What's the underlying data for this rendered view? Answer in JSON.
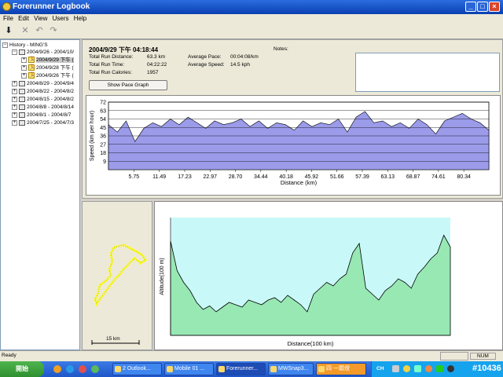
{
  "window": {
    "title": "Forerunner Logbook",
    "controls": [
      "_",
      "□",
      "×"
    ]
  },
  "menu": [
    "File",
    "Edit",
    "View",
    "Users",
    "Help"
  ],
  "tree": {
    "root": "History - MING'S",
    "weeks": [
      "2004/9/26 - 2004/10/",
      "2004/8/29 - 2004/9/4",
      "2004/8/22 - 2004/8/2",
      "2004/8/15 - 2004/8/2",
      "2004/8/8 - 2004/8/14",
      "2004/8/1 - 2004/8/7",
      "2004/7/25 - 2004/7/3"
    ],
    "runs": [
      "2004/9/29 下午 (",
      "2004/9/28 下午 (",
      "2004/9/26 下午 ("
    ]
  },
  "run": {
    "header": "2004/9/29 下午 04:18:44",
    "distance_label": "Total Run Distance:",
    "distance": "63.3 km",
    "time_label": "Total Run Time:",
    "time": "04:22:22",
    "calories_label": "Total Run Calories:",
    "calories": "1957",
    "pace_label": "Average Pace:",
    "pace": "00:04:08/km",
    "speed_label": "Average Speed:",
    "speed": "14.5 kph",
    "notes_label": "Notes:",
    "notes": ""
  },
  "pace_button": "Show Pace Graph",
  "colors": {
    "speed_fill": "#9b9bea",
    "alt_fill": "#98e8b4",
    "alt_sky": "#c9f8f8",
    "track": "#ffff00"
  },
  "chart_data": [
    {
      "type": "area",
      "xlabel": "Distance (km)",
      "ylabel": "Speed (km per hour)",
      "yticks": [
        9,
        18,
        27,
        36,
        45,
        54,
        63,
        72
      ],
      "xticks": [
        5.75,
        11.49,
        17.23,
        22.97,
        28.7,
        34.44,
        40.18,
        45.92,
        51.66,
        57.39,
        63.13,
        68.87,
        74.61,
        80.34
      ],
      "ylim": [
        0,
        72
      ],
      "xlim": [
        0,
        86
      ],
      "x": [
        0,
        2,
        4,
        6,
        8,
        10,
        12,
        14,
        16,
        18,
        20,
        22,
        24,
        26,
        28,
        30,
        32,
        34,
        36,
        38,
        40,
        42,
        44,
        46,
        48,
        50,
        52,
        54,
        56,
        58,
        60,
        62,
        64,
        66,
        68,
        70,
        72,
        74,
        76,
        78,
        80,
        82,
        84,
        86
      ],
      "y": [
        48,
        40,
        52,
        30,
        44,
        50,
        46,
        54,
        48,
        56,
        50,
        44,
        52,
        48,
        50,
        54,
        46,
        52,
        44,
        50,
        48,
        42,
        52,
        46,
        50,
        48,
        54,
        40,
        56,
        62,
        50,
        52,
        46,
        50,
        44,
        54,
        48,
        38,
        52,
        56,
        60,
        54,
        50,
        42
      ]
    },
    {
      "type": "area",
      "xlabel": "Distance(100 km)",
      "ylabel": "Altitude(100 m)",
      "x": [
        0,
        2,
        4,
        6,
        8,
        10,
        12,
        14,
        16,
        18,
        20,
        22,
        24,
        26,
        28,
        30,
        32,
        34,
        36,
        38,
        40,
        42,
        44,
        46,
        48,
        50,
        52,
        54,
        56,
        58,
        60,
        62,
        64,
        66,
        68,
        70,
        72,
        74,
        76,
        78,
        80,
        82,
        84,
        86
      ],
      "y": [
        80,
        55,
        45,
        38,
        28,
        22,
        25,
        20,
        24,
        28,
        26,
        24,
        30,
        28,
        26,
        30,
        32,
        28,
        34,
        30,
        26,
        20,
        35,
        40,
        45,
        42,
        48,
        52,
        70,
        78,
        40,
        35,
        30,
        38,
        42,
        48,
        45,
        40,
        52,
        58,
        65,
        70,
        85,
        75
      ],
      "ylim": [
        0,
        100
      ],
      "xlim": [
        0,
        86
      ]
    }
  ],
  "map": {
    "scale": "15 km"
  },
  "status": {
    "text": "Ready",
    "num": "NUM"
  },
  "taskbar": {
    "start": "開始",
    "tasks": [
      "2 Outlook...",
      "Mobile 01 ...",
      "Forerunner...",
      "MWSnap3...",
      "四 一顆燈"
    ],
    "tray": {
      "lang": "CH",
      "watermark": "#10436"
    }
  }
}
